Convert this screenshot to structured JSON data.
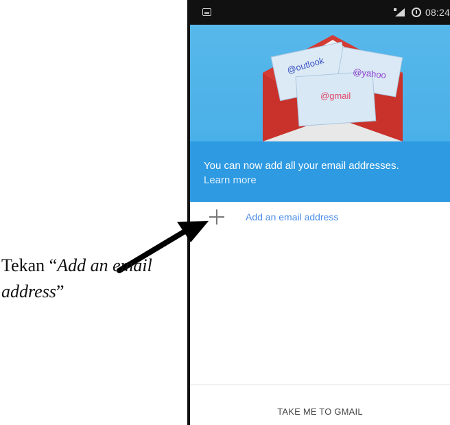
{
  "status_bar": {
    "time": "08:24",
    "left_icon": "notification-icon",
    "signal_icon": "signal-icon",
    "alarm_icon": "alarm-icon"
  },
  "hero": {
    "labels": {
      "outlook": "@outlook",
      "yahoo": "@yahoo",
      "gmail": "@gmail"
    },
    "message": "You can now add all your email addresses.",
    "learn_more": "Learn more"
  },
  "add_email": {
    "icon": "plus-icon",
    "label": "Add an email address"
  },
  "footer": {
    "button": "TAKE ME TO GMAIL"
  },
  "annotation": {
    "prefix": "Tekan “",
    "italic": "Add an email address",
    "suffix": "”"
  }
}
